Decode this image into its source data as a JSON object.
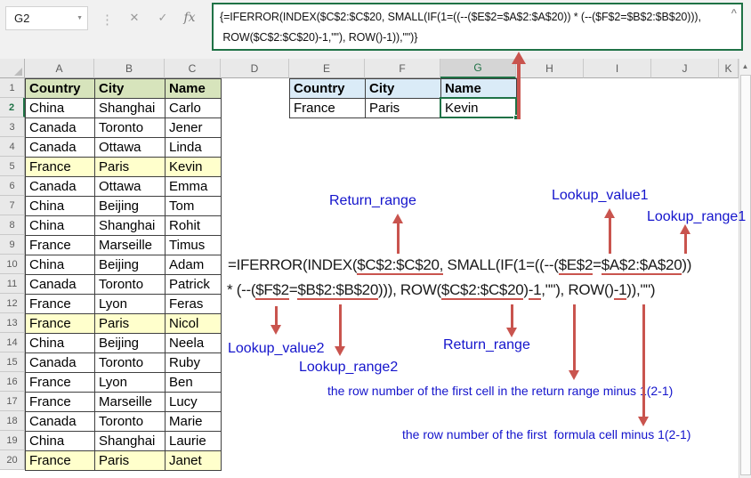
{
  "chrome": {
    "name_box_value": "G2",
    "formula_bar": {
      "line1": "{=IFERROR(INDEX($C$2:$C$20, SMALL(IF(1=((--($E$2=$A$2:$A$20)) * (--($F$2=$B$2:$B$20))),",
      "line2": " ROW($C$2:$C$20)-1,\"\"), ROW()-1)),\"\")}"
    },
    "icons": {
      "namebox_dropdown": "▼",
      "separator": "⋮",
      "cancel": "✕",
      "enter": "✓",
      "insert_function": "fx",
      "collapse": "^",
      "scroll_up": "▲"
    }
  },
  "grid": {
    "column_letters": [
      "A",
      "B",
      "C",
      "D",
      "E",
      "F",
      "G",
      "H",
      "I",
      "J",
      "K"
    ],
    "selected_column": "G",
    "selected_row": 2,
    "row_count": 20,
    "main_table": {
      "headers": [
        "Country",
        "City",
        "Name"
      ],
      "header_fill": "#D7E4BC",
      "highlight_fill": "#FFFFCC",
      "highlighted_rows": [
        5,
        13,
        20
      ],
      "rows": [
        [
          "China",
          "Shanghai",
          "Carlo"
        ],
        [
          "Canada",
          "Toronto",
          "Jener"
        ],
        [
          "Canada",
          "Ottawa",
          "Linda"
        ],
        [
          "France",
          "Paris",
          "Kevin"
        ],
        [
          "Canada",
          "Ottawa",
          "Emma"
        ],
        [
          "China",
          "Beijing",
          "Tom"
        ],
        [
          "China",
          "Shanghai",
          "Rohit"
        ],
        [
          "France",
          "Marseille",
          "Timus"
        ],
        [
          "China",
          "Beijing",
          "Adam"
        ],
        [
          "Canada",
          "Toronto",
          "Patrick"
        ],
        [
          "France",
          "Lyon",
          "Feras"
        ],
        [
          "France",
          "Paris",
          "Nicol"
        ],
        [
          "China",
          "Beijing",
          "Neela"
        ],
        [
          "Canada",
          "Toronto",
          "Ruby"
        ],
        [
          "France",
          "Lyon",
          "Ben"
        ],
        [
          "France",
          "Marseille",
          "Lucy"
        ],
        [
          "Canada",
          "Toronto",
          "Marie"
        ],
        [
          "China",
          "Shanghai",
          "Laurie"
        ],
        [
          "France",
          "Paris",
          "Janet"
        ]
      ]
    },
    "criteria_table": {
      "headers": [
        "Country",
        "City",
        "Name"
      ],
      "header_fill": "#DAEBF7",
      "row": [
        "France",
        "Paris",
        "Kevin"
      ],
      "selected_cell": "G2"
    }
  },
  "annotation": {
    "colors": {
      "red": "#C9544E",
      "blue": "#1414CC",
      "excel_green": "#1F7246"
    },
    "formula_line1_segments": [
      {
        "t": "=IFERROR(INDEX(",
        "u": 0
      },
      {
        "t": "$C$2:$C$20,",
        "u": 1
      },
      {
        "t": " SMALL(IF(1=((--(",
        "u": 0
      },
      {
        "t": "$E$2",
        "u": 1
      },
      {
        "t": "=",
        "u": 0
      },
      {
        "t": "$A$2:$A$20",
        "u": 1
      },
      {
        "t": "))",
        "u": 0
      }
    ],
    "formula_line2_segments": [
      {
        "t": "* (--(",
        "u": 0
      },
      {
        "t": "$F$2",
        "u": 1
      },
      {
        "t": "=",
        "u": 0
      },
      {
        "t": "$B$2:$B$20",
        "u": 1
      },
      {
        "t": "))), ROW(",
        "u": 0
      },
      {
        "t": "$C$2:$C$20",
        "u": 1
      },
      {
        "t": ")",
        "u": 0
      },
      {
        "t": "-1",
        "u": 1
      },
      {
        "t": ",\"\"), ROW()",
        "u": 0
      },
      {
        "t": "-1",
        "u": 1
      },
      {
        "t": ")),\"\")",
        "u": 0
      }
    ],
    "labels": {
      "return_range_top": "Return_range",
      "lookup_value1": "Lookup_value1",
      "lookup_range1": "Lookup_range1",
      "lookup_value2": "Lookup_value2",
      "lookup_range2": "Lookup_range2",
      "return_range_bottom": "Return_range",
      "note1": "the row number of the first cell in the return range minus 1(2-1)",
      "note2": "the row number of the first  formula cell minus 1(2-1)"
    }
  }
}
